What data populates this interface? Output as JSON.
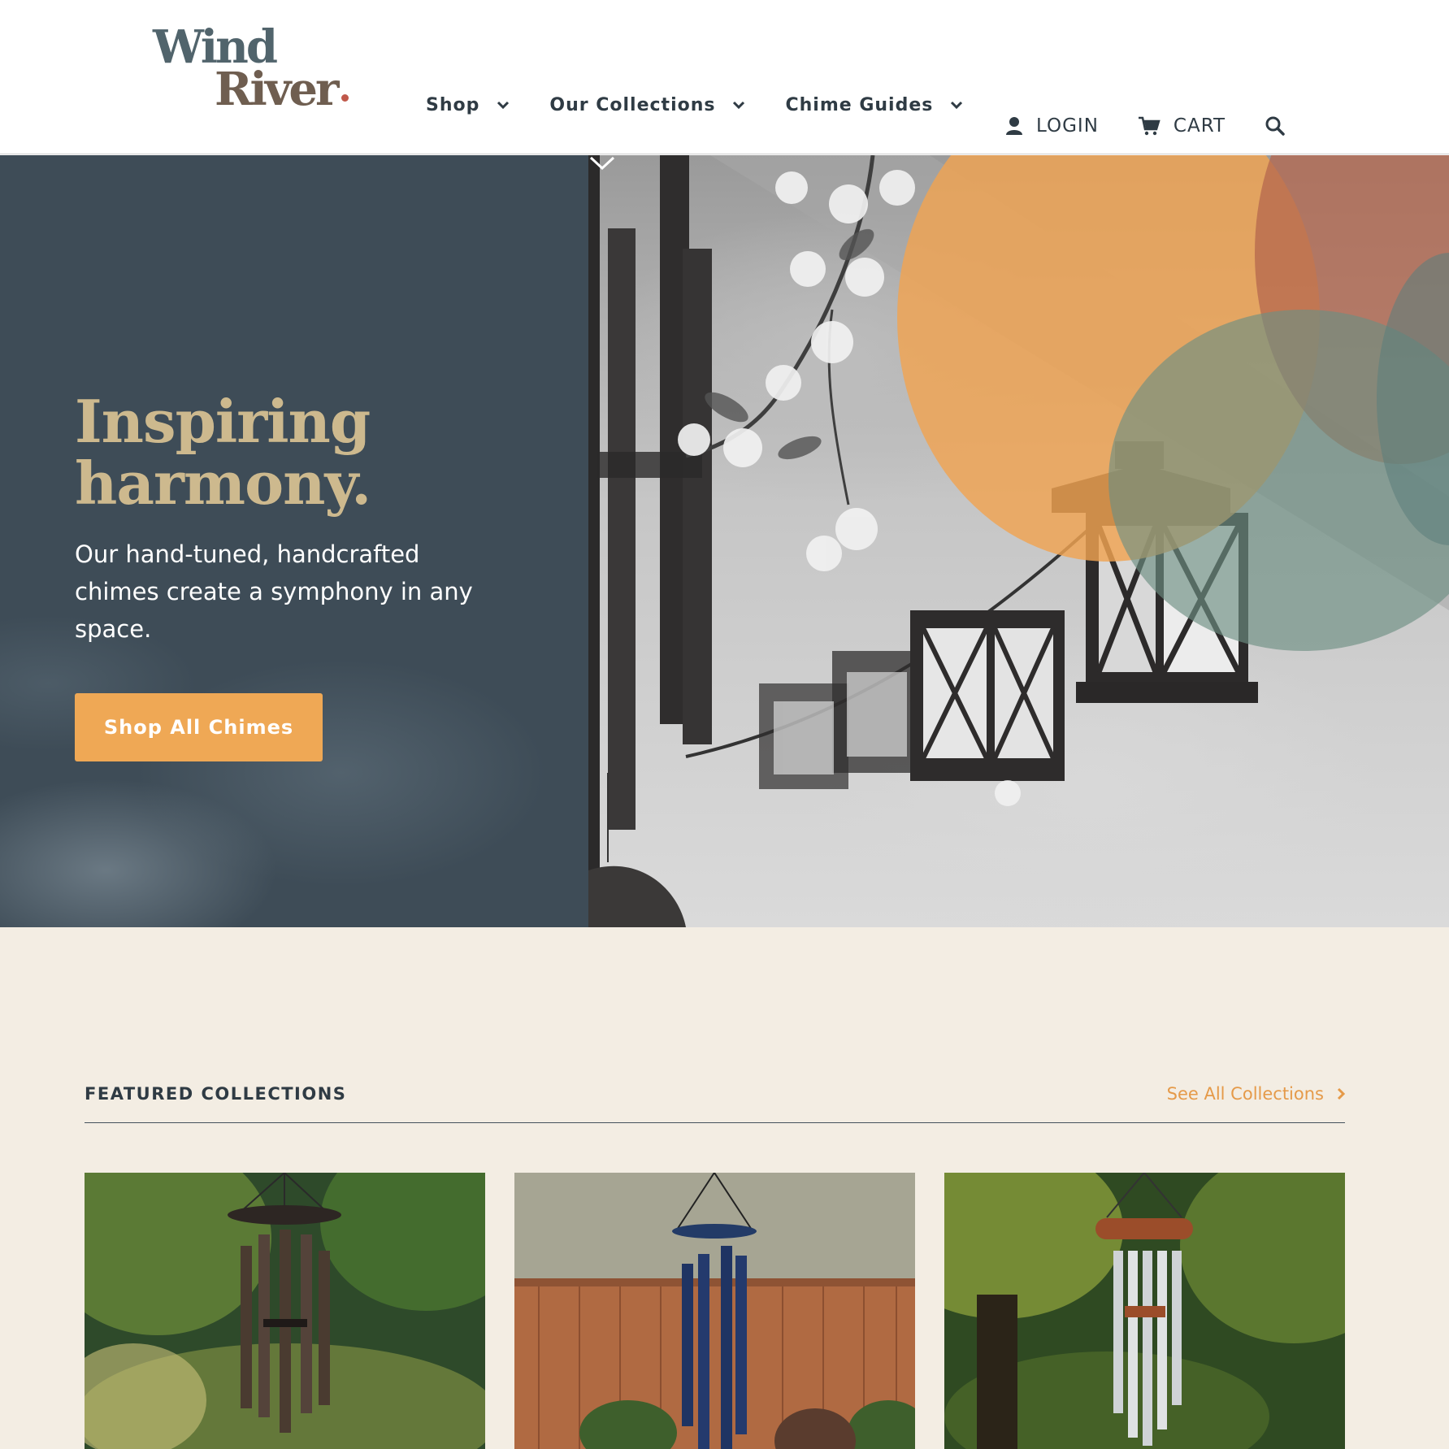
{
  "brand": {
    "line1": "Wind",
    "line2": "River"
  },
  "nav": [
    {
      "label": "Shop"
    },
    {
      "label": "Our Collections"
    },
    {
      "label": "Chime Guides"
    }
  ],
  "utility": {
    "login": "LOGIN",
    "cart": "CART"
  },
  "hero": {
    "title_line1": "Inspiring",
    "title_line2": "harmony.",
    "text": "Our hand-tuned, handcrafted chimes create a symphony in any space.",
    "button": "Shop All Chimes"
  },
  "featured": {
    "title": "FEATURED COLLECTIONS",
    "link": "See All Collections"
  },
  "icons": [
    "user-icon",
    "cart-icon",
    "search-icon",
    "chevron-down-icon",
    "chevron-right-icon"
  ],
  "colors": {
    "accent": "#efa855",
    "hero_bg": "#3e4c57",
    "title_gold": "#cdb98e",
    "link_orange": "#e59a49",
    "section_bg": "#f3ede3"
  }
}
